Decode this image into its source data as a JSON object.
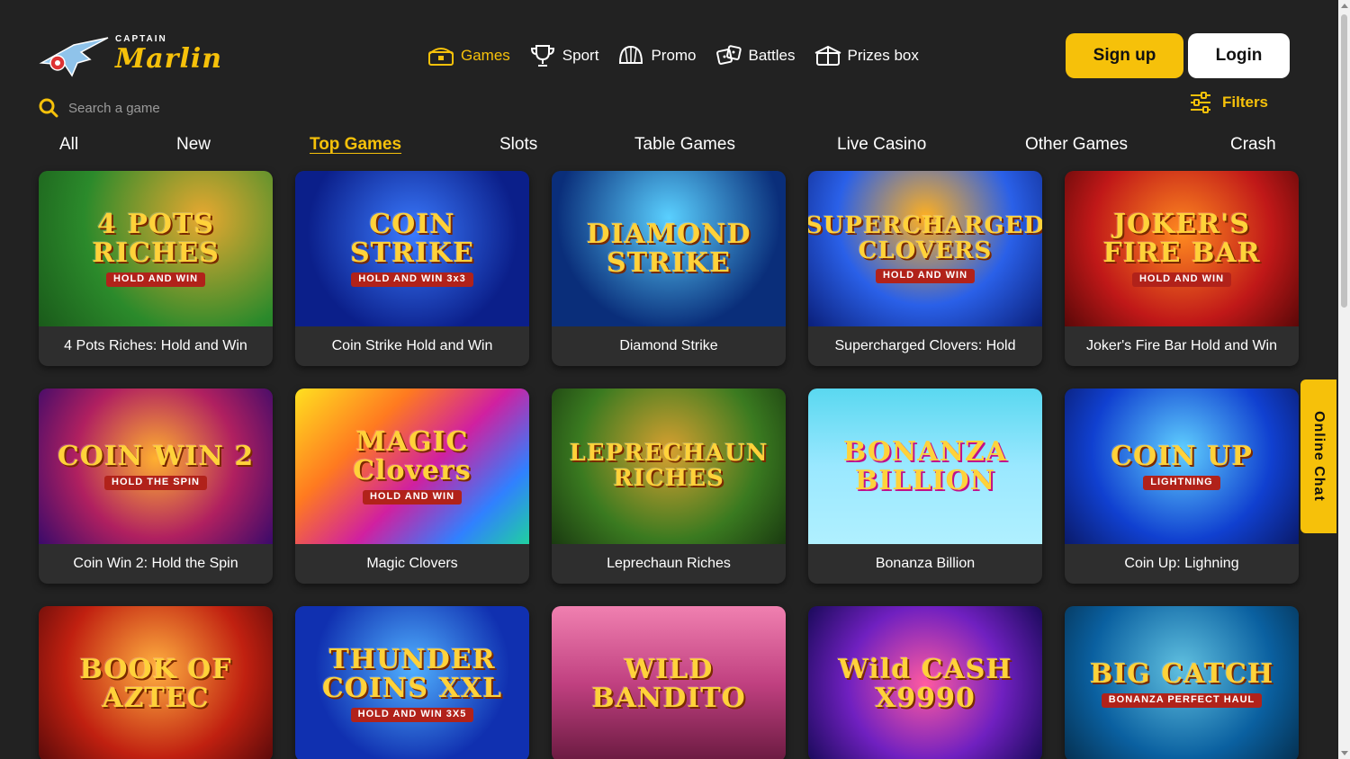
{
  "brand": {
    "small": "CAPTAIN",
    "big": "Marlin",
    "accent": "#f6c10a",
    "background": "#222222"
  },
  "nav": [
    {
      "label": "Games",
      "icon": "treasure-chest-icon",
      "active": true
    },
    {
      "label": "Sport",
      "icon": "trophy-icon",
      "active": false
    },
    {
      "label": "Promo",
      "icon": "shell-icon",
      "active": false
    },
    {
      "label": "Battles",
      "icon": "dice-icon",
      "active": false
    },
    {
      "label": "Prizes box",
      "icon": "gift-box-icon",
      "active": false
    }
  ],
  "auth": {
    "signup": "Sign up",
    "login": "Login"
  },
  "search": {
    "placeholder": "Search a game"
  },
  "filters": {
    "label": "Filters"
  },
  "categories": [
    {
      "label": "All",
      "active": false
    },
    {
      "label": "New",
      "active": false
    },
    {
      "label": "Top Games",
      "active": true
    },
    {
      "label": "Slots",
      "active": false
    },
    {
      "label": "Table Games",
      "active": false
    },
    {
      "label": "Live Casino",
      "active": false
    },
    {
      "label": "Other Games",
      "active": false
    },
    {
      "label": "Crash",
      "active": false
    }
  ],
  "games": [
    {
      "title": "4 Pots Riches: Hold and Win",
      "art": "4 POTS RICHES",
      "sub": "HOLD AND WIN"
    },
    {
      "title": "Coin Strike Hold and Win",
      "art": "COIN STRIKE",
      "sub": "HOLD AND WIN 3x3"
    },
    {
      "title": "Diamond Strike",
      "art": "DIAMOND STRIKE",
      "sub": ""
    },
    {
      "title": "Supercharged Clovers: Hold",
      "art": "SUPERCHARGED CLOVERS",
      "sub": "HOLD AND WIN"
    },
    {
      "title": "Joker's Fire Bar Hold and Win",
      "art": "JOKER'S FIRE BAR",
      "sub": "HOLD AND WIN"
    },
    {
      "title": "Coin Win 2: Hold the Spin",
      "art": "COIN WIN 2",
      "sub": "HOLD THE SPIN"
    },
    {
      "title": "Magic Clovers",
      "art": "MAGIC Clovers",
      "sub": "HOLD AND WIN"
    },
    {
      "title": "Leprechaun Riches",
      "art": "LEPRECHAUN RICHES",
      "sub": ""
    },
    {
      "title": "Bonanza Billion",
      "art": "BONANZA BILLION",
      "sub": ""
    },
    {
      "title": "Coin Up: Lighning",
      "art": "COIN UP",
      "sub": "LIGHTNING"
    },
    {
      "title": "",
      "art": "BOOK OF AZTEC",
      "sub": ""
    },
    {
      "title": "",
      "art": "THUNDER COINS XXL",
      "sub": "HOLD AND WIN 3X5"
    },
    {
      "title": "",
      "art": "WILD BANDITO",
      "sub": ""
    },
    {
      "title": "",
      "art": "Wild CASH X9990",
      "sub": ""
    },
    {
      "title": "",
      "art": "BIG CATCH",
      "sub": "BONANZA PERFECT HAUL"
    }
  ],
  "chat": {
    "label": "Online Chat"
  }
}
